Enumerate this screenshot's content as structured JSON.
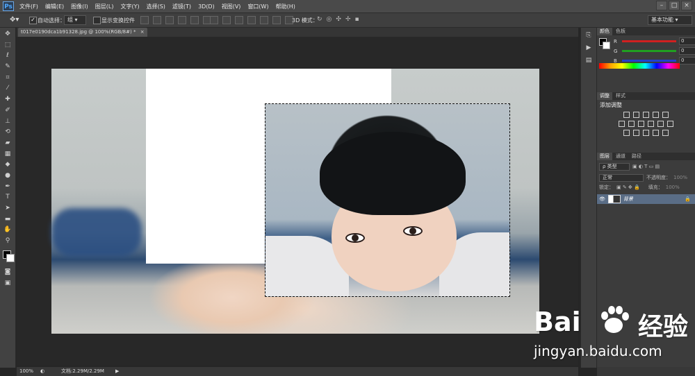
{
  "app": {
    "logo": "Ps"
  },
  "menu": [
    "文件(F)",
    "编辑(E)",
    "图像(I)",
    "图层(L)",
    "文字(Y)",
    "选择(S)",
    "滤镜(T)",
    "3D(D)",
    "视图(V)",
    "窗口(W)",
    "帮助(H)"
  ],
  "window_controls": {
    "minimize": "–",
    "maximize": "□",
    "close": "×"
  },
  "options_bar": {
    "auto_select_label": "自动选择：",
    "auto_select_value": "组",
    "show_transform_label": "显示变换控件",
    "mode_3d_label": "3D 模式：",
    "workspace": "基本功能"
  },
  "document": {
    "tab_title": "t017e0190dca1b91328.jpg @ 100%(RGB/8#) *",
    "close": "×"
  },
  "color_panel": {
    "tabs": [
      "颜色",
      "色板"
    ],
    "channels": [
      {
        "name": "R",
        "value": "0",
        "color": "#d02020"
      },
      {
        "name": "G",
        "value": "0",
        "color": "#20a020"
      },
      {
        "name": "B",
        "value": "0",
        "color": "#2040d0"
      }
    ]
  },
  "adjustments_panel": {
    "tabs": [
      "调整",
      "样式"
    ],
    "title": "添加调整"
  },
  "layers_panel": {
    "tabs": [
      "图层",
      "通道",
      "路径"
    ],
    "kind_label": "ρ 类型",
    "blend_mode": "正常",
    "opacity_label": "不透明度：",
    "opacity_value": "100%",
    "lock_label": "锁定：",
    "fill_label": "填充：",
    "fill_value": "100%",
    "layers": [
      {
        "name": "背景"
      }
    ]
  },
  "status_bar": {
    "zoom": "100%",
    "doc_size": "文档:2.29M/2.29M"
  },
  "watermark": {
    "brand": "Bai",
    "brand_cn": "经验",
    "url": "jingyan.baidu.com"
  }
}
